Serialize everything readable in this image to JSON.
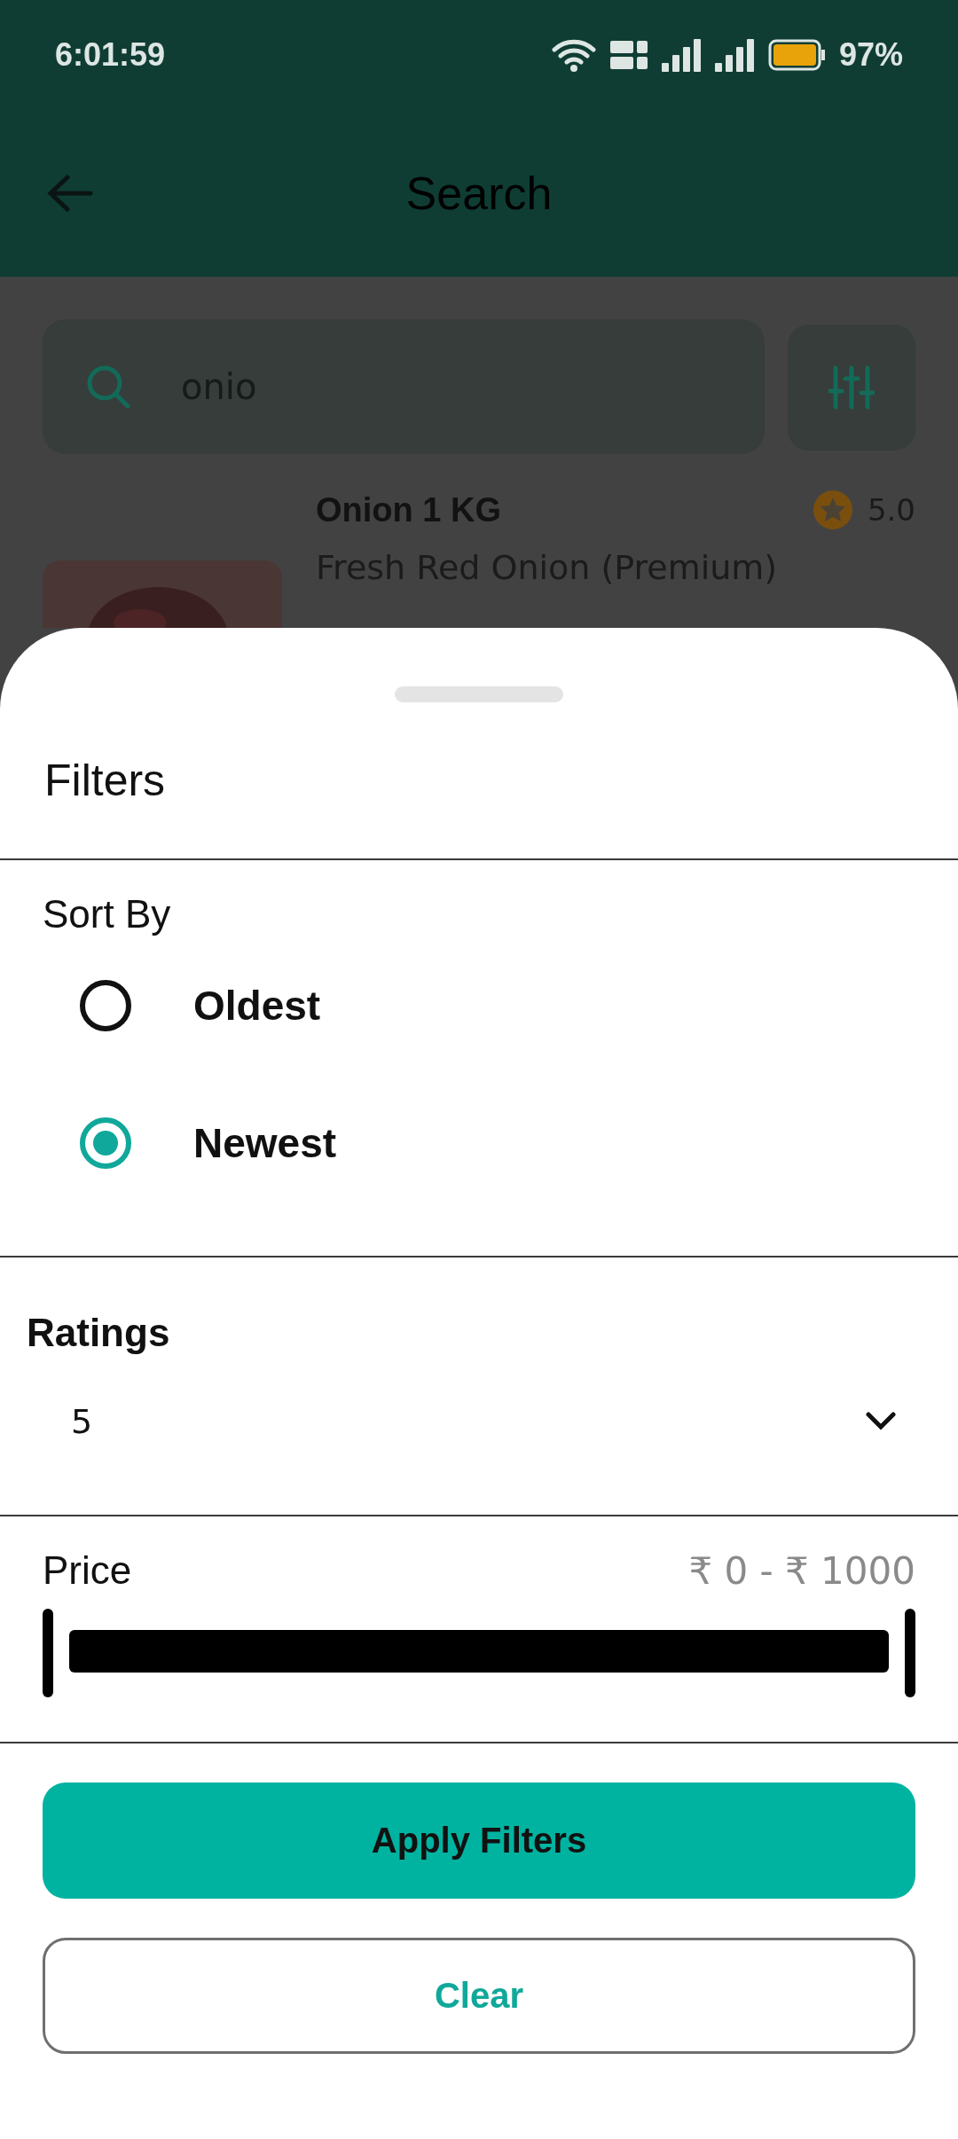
{
  "status_bar": {
    "time": "6:01:59",
    "battery": "97%"
  },
  "header": {
    "title": "Search"
  },
  "search": {
    "value": "onio"
  },
  "product": {
    "name": "Onion 1 KG",
    "rating": "5.0",
    "description": "Fresh Red Onion (Premium)"
  },
  "filters": {
    "title": "Filters",
    "sort": {
      "label": "Sort By",
      "options": [
        {
          "label": "Oldest",
          "selected": false
        },
        {
          "label": "Newest",
          "selected": true
        }
      ]
    },
    "ratings": {
      "label": "Ratings",
      "value": "5"
    },
    "price": {
      "label": "Price",
      "range": "₹ 0 - ₹ 1000"
    },
    "buttons": [
      {
        "label": "Apply Filters",
        "kind": "primary"
      },
      {
        "label": "Clear",
        "kind": "outline"
      }
    ]
  }
}
